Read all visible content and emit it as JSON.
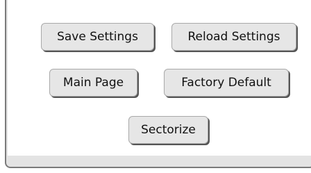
{
  "buttons": {
    "save_settings": "Save Settings",
    "reload_settings": "Reload Settings",
    "main_page": "Main Page",
    "factory_default": "Factory Default",
    "sectorize": "Sectorize"
  },
  "colors": {
    "frame_background": "#e3e3e3",
    "frame_border": "#7a7a7a",
    "panel_background": "#ffffff",
    "button_background": "#e6e6e6",
    "button_shadow": "#555555"
  }
}
